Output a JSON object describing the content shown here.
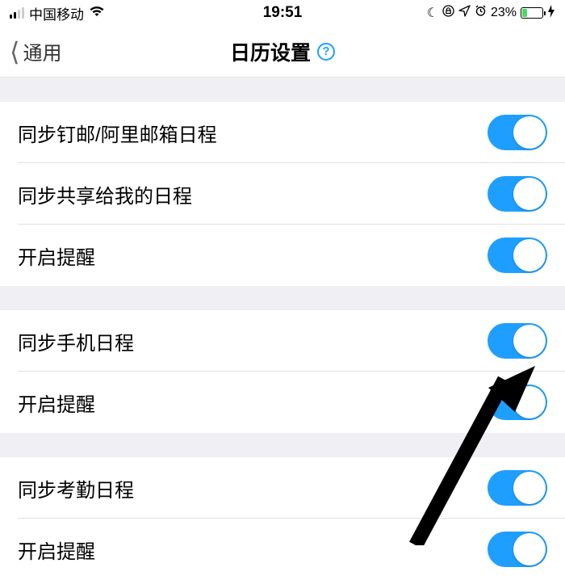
{
  "status": {
    "carrier": "中国移动",
    "time": "19:51",
    "battery_pct": "23%"
  },
  "nav": {
    "back_label": "通用",
    "title": "日历设置"
  },
  "sections": [
    {
      "rows": [
        {
          "label": "同步钉邮/阿里邮箱日程",
          "on": true
        },
        {
          "label": "同步共享给我的日程",
          "on": true
        },
        {
          "label": "开启提醒",
          "on": true
        }
      ]
    },
    {
      "rows": [
        {
          "label": "同步手机日程",
          "on": true
        },
        {
          "label": "开启提醒",
          "on": true
        }
      ]
    },
    {
      "rows": [
        {
          "label": "同步考勤日程",
          "on": true
        },
        {
          "label": "开启提醒",
          "on": true
        }
      ]
    }
  ]
}
